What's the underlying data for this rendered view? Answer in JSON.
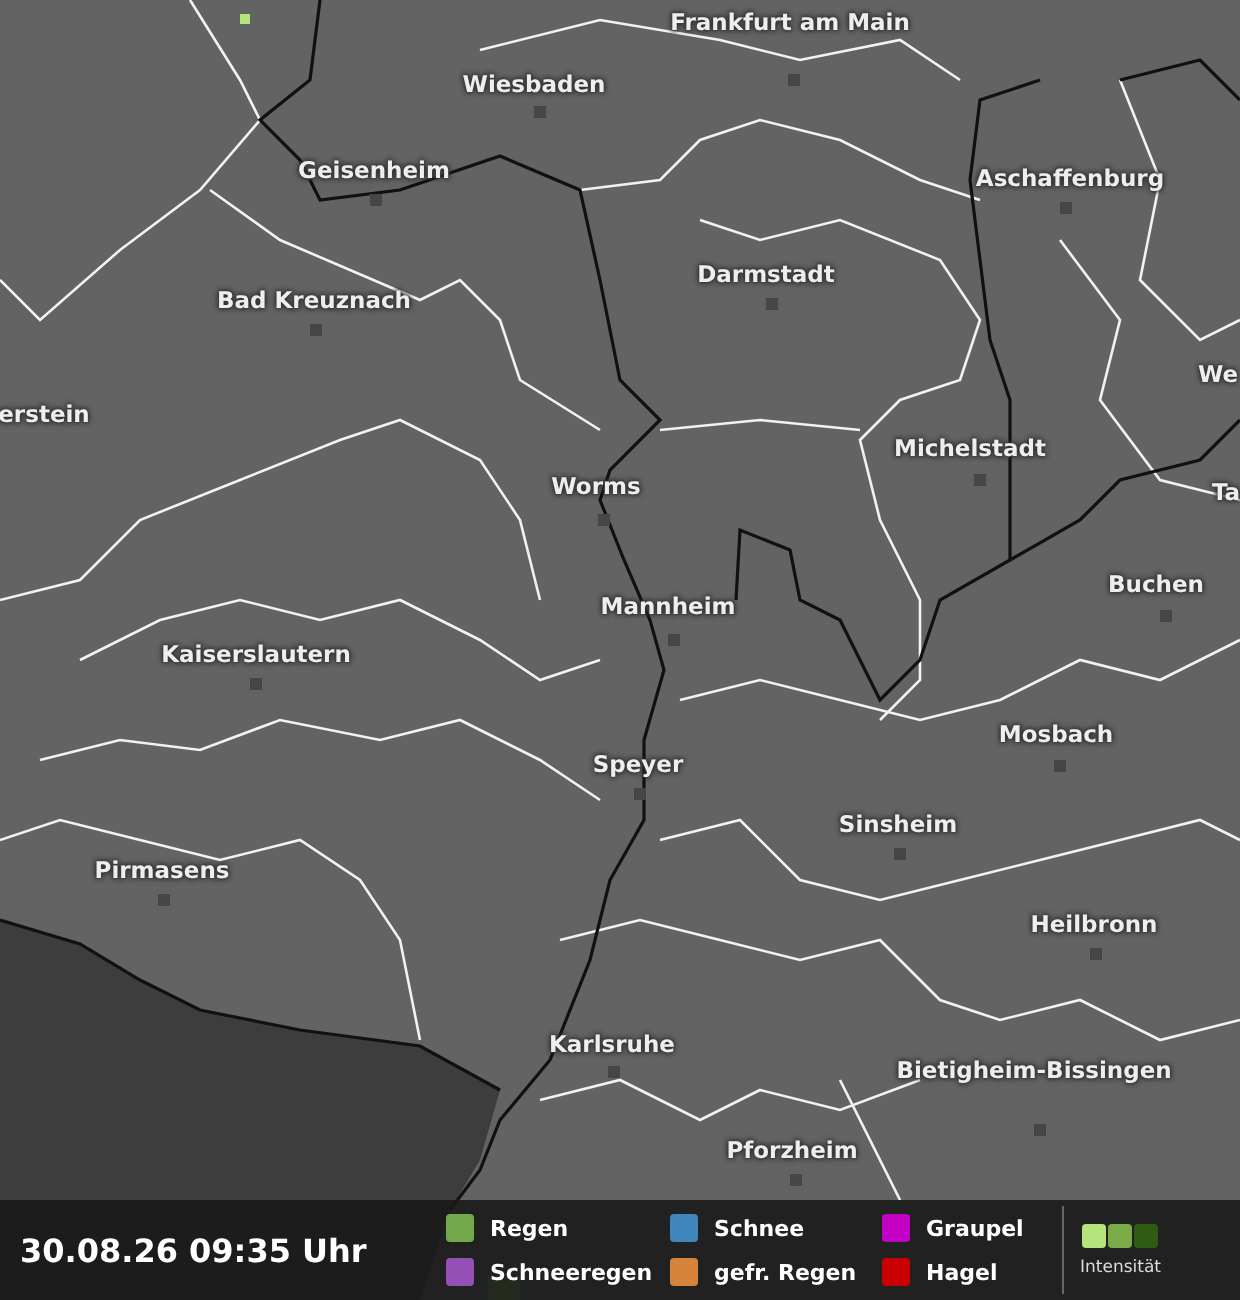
{
  "map": {
    "cities": [
      {
        "name": "Frankfurt am Main",
        "marker": true
      },
      {
        "name": "Wiesbaden",
        "marker": true
      },
      {
        "name": "Geisenheim",
        "marker": true
      },
      {
        "name": "Aschaffenburg",
        "marker": true
      },
      {
        "name": "Bad Kreuznach",
        "marker": true
      },
      {
        "name": "Darmstadt",
        "marker": true
      },
      {
        "name": "We",
        "marker": false
      },
      {
        "name": "erstein",
        "marker": false
      },
      {
        "name": "Worms",
        "marker": true
      },
      {
        "name": "Michelstadt",
        "marker": true
      },
      {
        "name": "Ta",
        "marker": false
      },
      {
        "name": "Buchen",
        "marker": true
      },
      {
        "name": "Mannheim",
        "marker": true
      },
      {
        "name": "Kaiserslautern",
        "marker": true
      },
      {
        "name": "Mosbach",
        "marker": true
      },
      {
        "name": "Speyer",
        "marker": true
      },
      {
        "name": "Sinsheim",
        "marker": true
      },
      {
        "name": "Pirmasens",
        "marker": true
      },
      {
        "name": "Heilbronn",
        "marker": true
      },
      {
        "name": "Karlsruhe",
        "marker": true
      },
      {
        "name": "Bietigheim-Bissingen",
        "marker": true
      },
      {
        "name": "Pforzheim",
        "marker": true
      }
    ]
  },
  "legend": {
    "timestamp": "30.08.26 09:35 Uhr",
    "precipitation_types": [
      {
        "label": "Regen",
        "color": "#74a84a"
      },
      {
        "label": "Schneeregen",
        "color": "#9550b8"
      },
      {
        "label": "Schnee",
        "color": "#3f86bd"
      },
      {
        "label": "gefr. Regen",
        "color": "#d6843a"
      },
      {
        "label": "Graupel",
        "color": "#c400c4"
      },
      {
        "label": "Hagel",
        "color": "#c80000"
      }
    ],
    "intensity": {
      "label": "Intensität",
      "swatches": [
        {
          "color": "#b5e37c"
        },
        {
          "color": "#7bab48"
        },
        {
          "color": "#2f5c12"
        }
      ]
    }
  }
}
